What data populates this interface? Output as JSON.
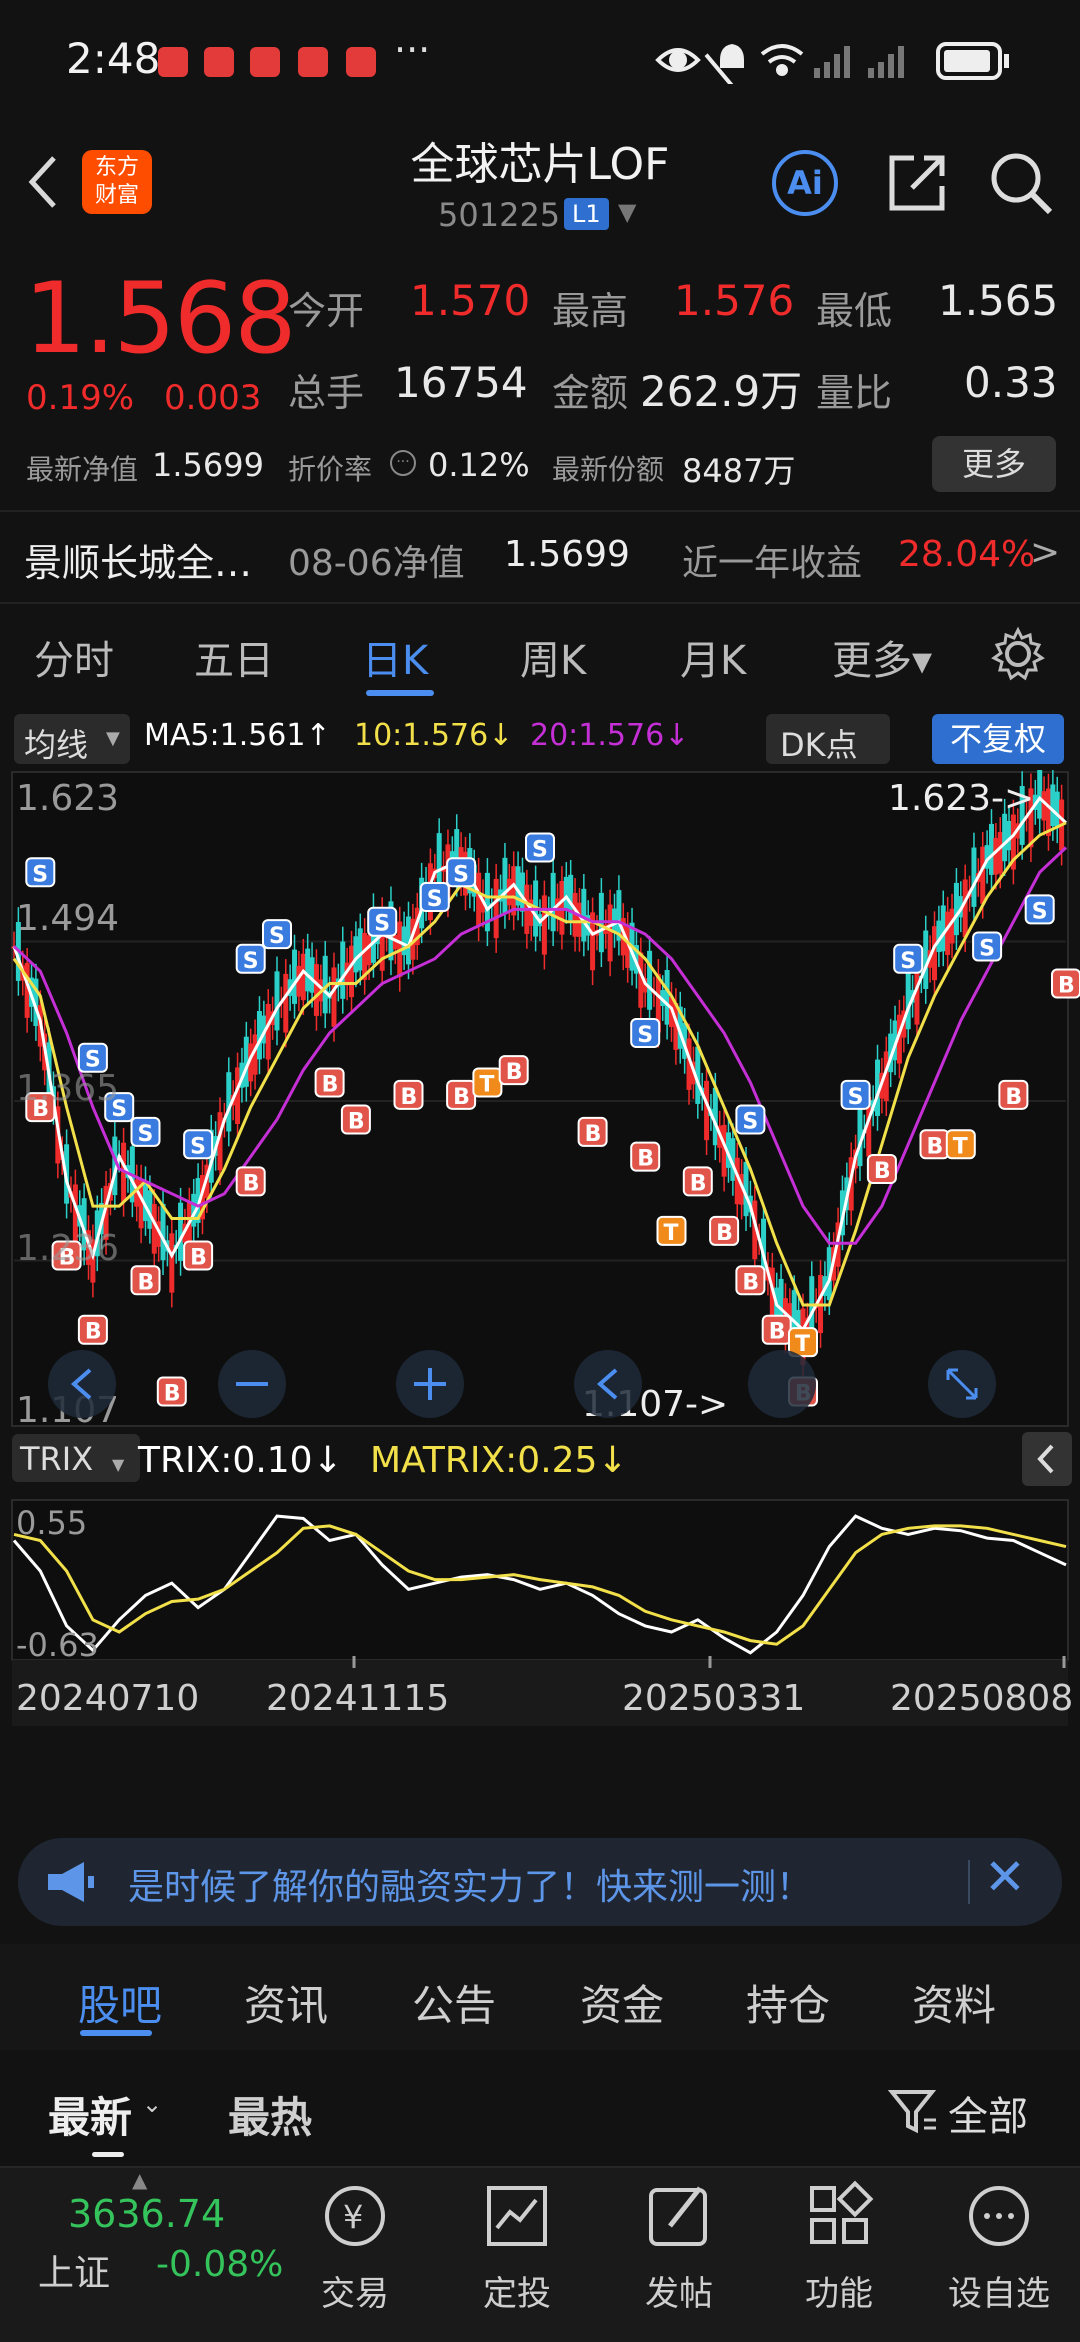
{
  "status_bar": {
    "time": "2:48",
    "dots": "···"
  },
  "header": {
    "logo_text_1": "东方",
    "logo_text_2": "财富",
    "title": "全球芯片LOF",
    "code": "501225",
    "level_badge": "L1",
    "ai_label": "Ai"
  },
  "quote": {
    "price": "1.568",
    "pct": "0.19%",
    "change": "0.003",
    "open_label": "今开",
    "open": "1.570",
    "high_label": "最高",
    "high": "1.576",
    "low_label": "最低",
    "low": "1.565",
    "volume_label": "总手",
    "volume": "16754",
    "amount_label": "金额",
    "amount": "262.9万",
    "ratio_label": "量比",
    "ratio": "0.33",
    "nav_label": "最新净值",
    "nav": "1.5699",
    "discount_label": "折价率",
    "discount": "0.12%",
    "shares_label": "最新份额",
    "shares": "8487万",
    "more_label": "更多"
  },
  "fund_row": {
    "name": "景顺长城全…",
    "nav_date_label": "08-06净值",
    "nav_value": "1.5699",
    "return_label": "近一年收益",
    "return_value": "28.04%",
    "arrow": ">"
  },
  "k_tabs": [
    "分时",
    "五日",
    "日K",
    "周K",
    "月K",
    "更多▾"
  ],
  "ma_bar": {
    "selector": "均线",
    "ma5": "MA5:1.561↑",
    "ma10": "10:1.576↓",
    "ma20": "20:1.576↓",
    "dk": "DK点",
    "adjust": "不复权"
  },
  "colors": {
    "up": "#f02b2b",
    "down": "#35c35c",
    "accent": "#4b8ef0",
    "ma5": "#ffffff",
    "ma10": "#f2e04a",
    "ma20": "#c52fd6"
  },
  "chart_data": {
    "type": "line",
    "main_y_labels": [
      "1.623",
      "1.494",
      "1.365",
      "1.236",
      "1.107"
    ],
    "max_marker": "1.623->",
    "min_marker": "1.107->",
    "ylim": [
      1.107,
      1.623
    ],
    "x_labels": [
      "20240710",
      "20241115",
      "20250331",
      "20250808"
    ],
    "trix_selector": "TRIX",
    "trix_label": "TRIX:0.10↓",
    "matrix_label": "MATRIX:0.25↓",
    "trix_y_labels": [
      "0.55",
      "-0.63"
    ],
    "trix_ylim": [
      -0.63,
      0.55
    ],
    "series": [
      {
        "name": "MA5",
        "values": [
          1.49,
          1.43,
          1.3,
          1.24,
          1.32,
          1.28,
          1.24,
          1.28,
          1.35,
          1.4,
          1.44,
          1.47,
          1.45,
          1.48,
          1.5,
          1.49,
          1.55,
          1.56,
          1.52,
          1.54,
          1.51,
          1.53,
          1.5,
          1.51,
          1.46,
          1.44,
          1.38,
          1.33,
          1.28,
          1.2,
          1.18,
          1.22,
          1.32,
          1.38,
          1.44,
          1.49,
          1.52,
          1.56,
          1.58,
          1.61,
          1.59
        ]
      },
      {
        "name": "10",
        "values": [
          1.48,
          1.45,
          1.36,
          1.28,
          1.28,
          1.3,
          1.27,
          1.27,
          1.31,
          1.36,
          1.4,
          1.44,
          1.46,
          1.46,
          1.48,
          1.49,
          1.51,
          1.54,
          1.53,
          1.53,
          1.52,
          1.51,
          1.51,
          1.5,
          1.48,
          1.45,
          1.41,
          1.36,
          1.31,
          1.25,
          1.2,
          1.2,
          1.26,
          1.33,
          1.4,
          1.45,
          1.49,
          1.53,
          1.56,
          1.58,
          1.59
        ]
      },
      {
        "name": "20",
        "values": [
          1.49,
          1.47,
          1.42,
          1.36,
          1.31,
          1.3,
          1.29,
          1.28,
          1.29,
          1.32,
          1.35,
          1.39,
          1.42,
          1.44,
          1.46,
          1.47,
          1.48,
          1.5,
          1.51,
          1.52,
          1.52,
          1.52,
          1.51,
          1.51,
          1.5,
          1.48,
          1.45,
          1.42,
          1.38,
          1.33,
          1.28,
          1.25,
          1.25,
          1.28,
          1.33,
          1.38,
          1.43,
          1.47,
          1.51,
          1.55,
          1.57
        ]
      },
      {
        "name": "TRIX",
        "values": [
          0.3,
          0.05,
          -0.4,
          -0.6,
          -0.35,
          -0.15,
          -0.05,
          -0.25,
          -0.1,
          0.2,
          0.5,
          0.48,
          0.3,
          0.35,
          0.1,
          -0.1,
          -0.05,
          0.0,
          0.02,
          -0.02,
          -0.1,
          -0.05,
          -0.15,
          -0.3,
          -0.4,
          -0.45,
          -0.35,
          -0.5,
          -0.62,
          -0.45,
          -0.15,
          0.25,
          0.5,
          0.4,
          0.35,
          0.4,
          0.38,
          0.32,
          0.3,
          0.2,
          0.1
        ]
      },
      {
        "name": "MATRIX",
        "values": [
          0.35,
          0.3,
          0.05,
          -0.35,
          -0.45,
          -0.3,
          -0.2,
          -0.18,
          -0.1,
          0.05,
          0.2,
          0.4,
          0.42,
          0.35,
          0.2,
          0.05,
          -0.02,
          -0.02,
          0.0,
          0.02,
          -0.02,
          -0.05,
          -0.08,
          -0.15,
          -0.28,
          -0.35,
          -0.4,
          -0.45,
          -0.52,
          -0.55,
          -0.4,
          -0.1,
          0.2,
          0.35,
          0.4,
          0.42,
          0.42,
          0.4,
          0.35,
          0.3,
          0.25
        ]
      }
    ],
    "signals": [
      {
        "t": "S",
        "i": 1,
        "v": 1.55
      },
      {
        "t": "B",
        "i": 1,
        "v": 1.36
      },
      {
        "t": "B",
        "i": 2,
        "v": 1.24
      },
      {
        "t": "B",
        "i": 3,
        "v": 1.18
      },
      {
        "t": "S",
        "i": 3,
        "v": 1.4
      },
      {
        "t": "S",
        "i": 4,
        "v": 1.36
      },
      {
        "t": "B",
        "i": 5,
        "v": 1.22
      },
      {
        "t": "B",
        "i": 6,
        "v": 1.13
      },
      {
        "t": "S",
        "i": 5,
        "v": 1.34
      },
      {
        "t": "S",
        "i": 7,
        "v": 1.33
      },
      {
        "t": "B",
        "i": 7,
        "v": 1.24
      },
      {
        "t": "S",
        "i": 9,
        "v": 1.48
      },
      {
        "t": "S",
        "i": 10,
        "v": 1.5
      },
      {
        "t": "B",
        "i": 9,
        "v": 1.3
      },
      {
        "t": "B",
        "i": 12,
        "v": 1.38
      },
      {
        "t": "B",
        "i": 13,
        "v": 1.35
      },
      {
        "t": "S",
        "i": 14,
        "v": 1.51
      },
      {
        "t": "B",
        "i": 15,
        "v": 1.37
      },
      {
        "t": "S",
        "i": 16,
        "v": 1.53
      },
      {
        "t": "S",
        "i": 17,
        "v": 1.55
      },
      {
        "t": "B",
        "i": 17,
        "v": 1.37
      },
      {
        "t": "T",
        "i": 18,
        "v": 1.38
      },
      {
        "t": "B",
        "i": 19,
        "v": 1.39
      },
      {
        "t": "S",
        "i": 20,
        "v": 1.57
      },
      {
        "t": "B",
        "i": 22,
        "v": 1.34
      },
      {
        "t": "S",
        "i": 24,
        "v": 1.42
      },
      {
        "t": "B",
        "i": 24,
        "v": 1.32
      },
      {
        "t": "T",
        "i": 25,
        "v": 1.26
      },
      {
        "t": "B",
        "i": 26,
        "v": 1.3
      },
      {
        "t": "B",
        "i": 27,
        "v": 1.26
      },
      {
        "t": "B",
        "i": 28,
        "v": 1.22
      },
      {
        "t": "S",
        "i": 28,
        "v": 1.35
      },
      {
        "t": "B",
        "i": 29,
        "v": 1.18
      },
      {
        "t": "T",
        "i": 30,
        "v": 1.17
      },
      {
        "t": "B",
        "i": 30,
        "v": 1.13
      },
      {
        "t": "S",
        "i": 32,
        "v": 1.37
      },
      {
        "t": "B",
        "i": 33,
        "v": 1.31
      },
      {
        "t": "S",
        "i": 34,
        "v": 1.48
      },
      {
        "t": "B",
        "i": 35,
        "v": 1.33
      },
      {
        "t": "T",
        "i": 36,
        "v": 1.33
      },
      {
        "t": "S",
        "i": 37,
        "v": 1.49
      },
      {
        "t": "B",
        "i": 38,
        "v": 1.37
      },
      {
        "t": "S",
        "i": 39,
        "v": 1.52
      },
      {
        "t": "B",
        "i": 40,
        "v": 1.46
      }
    ]
  },
  "banner": {
    "text": "是时候了解你的融资实力了！快来测一测！",
    "close": "✕"
  },
  "section_tabs": [
    "股吧",
    "资讯",
    "公告",
    "资金",
    "持仓",
    "资料"
  ],
  "filter_bar": {
    "latest": "最新",
    "hot": "最热",
    "all": "全部"
  },
  "bottom_nav": {
    "index_value": "3636.74",
    "index_name": "上证",
    "index_change": "-0.08%",
    "items": [
      "交易",
      "定投",
      "发帖",
      "功能",
      "设自选"
    ]
  }
}
